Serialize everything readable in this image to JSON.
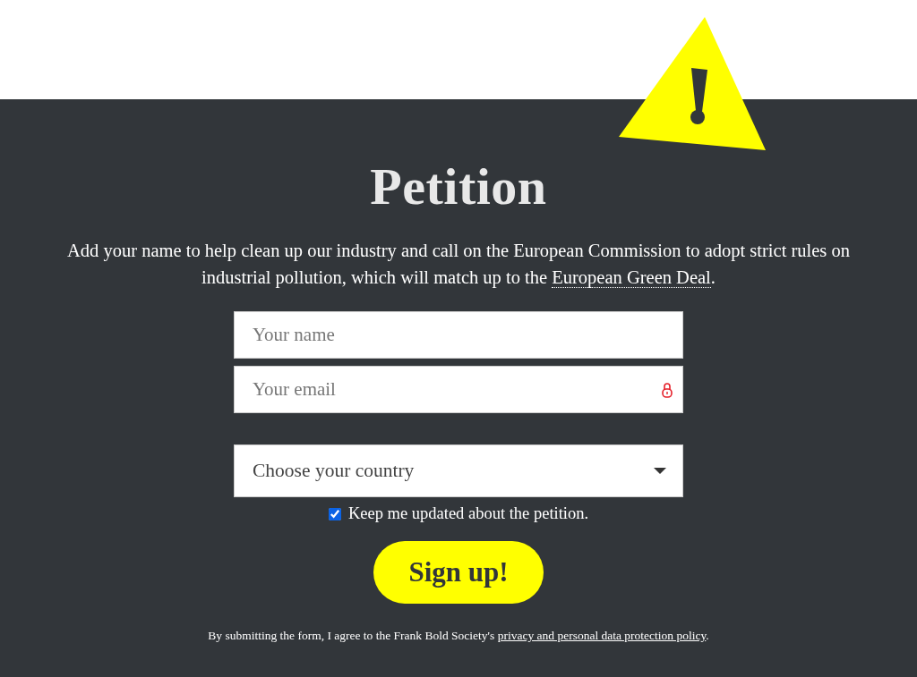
{
  "title": "Petition",
  "intro": {
    "text": "Add your name to help clean up our industry and call on the European Commission to adopt strict rules on industrial pollution, which will match up to the ",
    "link": "European Green Deal",
    "after": "."
  },
  "fields": [
    {
      "kind": "text",
      "placeholder": "Your name"
    },
    {
      "kind": "email",
      "placeholder": "Your email"
    },
    {
      "kind": "select",
      "value": "Choose your country"
    }
  ],
  "consent": {
    "label": "Keep me updated about the petition.",
    "checked": true
  },
  "submit": "Sign up!",
  "footer": {
    "text": "By submitting the form, I agree to the Frank Bold Society's ",
    "link": "privacy and personal data protection policy",
    "after": "."
  }
}
